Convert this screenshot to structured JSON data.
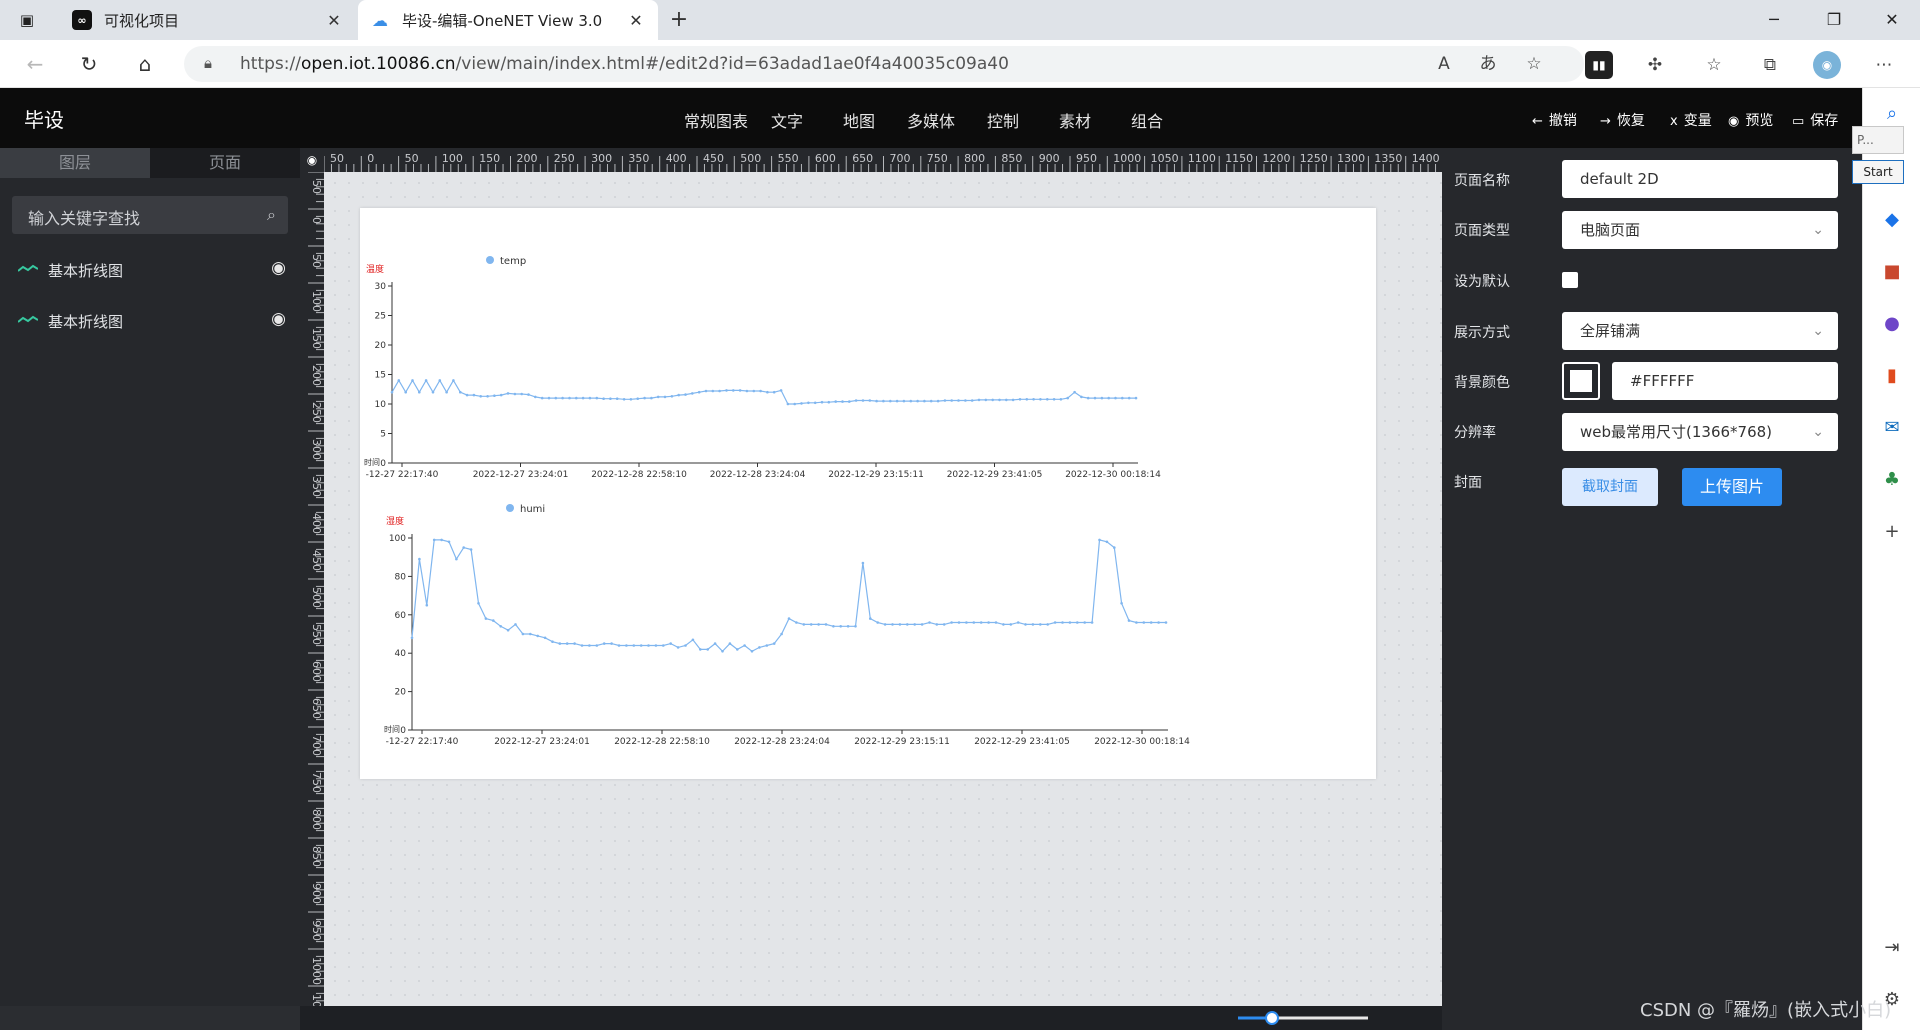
{
  "browser": {
    "tabs": [
      {
        "title": "可视化项目",
        "favicon": "onenet-logo"
      },
      {
        "title": "毕设-编辑-OneNET View 3.0",
        "favicon": "cloud-icon"
      }
    ],
    "url_prefix": "https://",
    "url_host": "open.iot.10086.cn",
    "url_path": "/view/main/index.html#/edit2d?id=63adad1ae0f4a40035c09a40"
  },
  "app": {
    "title": "毕设",
    "menu": [
      "常规图表",
      "文字",
      "地图",
      "多媒体",
      "控制",
      "素材",
      "组合"
    ],
    "tools": {
      "undo": "撤销",
      "redo": "恢复",
      "variable": "变量",
      "preview": "预览",
      "save": "保存"
    }
  },
  "left_panel": {
    "tabs": [
      "图层",
      "页面"
    ],
    "search_placeholder": "输入关键字查找",
    "layers": [
      "基本折线图",
      "基本折线图"
    ]
  },
  "ruler": {
    "h_labels": [
      "50",
      "0",
      "50",
      "100",
      "150",
      "200",
      "250",
      "300",
      "350",
      "400",
      "450",
      "500",
      "550",
      "600",
      "650",
      "700",
      "750",
      "800",
      "850",
      "900",
      "950",
      "1000",
      "1050",
      "1100",
      "1150",
      "1200",
      "1250",
      "1300",
      "1350",
      "1400"
    ],
    "v_labels": [
      "50",
      "0",
      "50",
      "100",
      "150",
      "200",
      "250",
      "300",
      "350",
      "400",
      "450",
      "500",
      "550",
      "600",
      "650",
      "700",
      "750",
      "800",
      "850",
      "900",
      "950",
      "1000",
      "10"
    ]
  },
  "right_panel": {
    "page_name_label": "页面名称",
    "page_name_value": "default 2D",
    "page_type_label": "页面类型",
    "page_type_value": "电脑页面",
    "default_label": "设为默认",
    "display_label": "展示方式",
    "display_value": "全屏铺满",
    "bg_label": "背景颜色",
    "bg_value": "#FFFFFF",
    "resolution_label": "分辨率",
    "resolution_value": "web最常用尺寸(1366*768)",
    "cover_label": "封面",
    "capture_btn": "截取封面",
    "upload_btn": "上传图片"
  },
  "edge_popups": {
    "p_label": "P...",
    "start_label": "Start"
  },
  "watermark": "CSDN @『羅炀』(嵌入式小白)",
  "chart_data": [
    {
      "type": "line",
      "series_name": "temp",
      "ylabel": "温度",
      "xlabel_short": "时间",
      "ylim": [
        0,
        30
      ],
      "yticks": [
        0,
        5,
        10,
        15,
        20,
        25,
        30
      ],
      "xtick_labels": [
        "-12-27 22:17:40",
        "2022-12-27 23:24:01",
        "2022-12-28 22:58:10",
        "2022-12-28 23:24:04",
        "2022-12-29 23:15:11",
        "2022-12-29 23:41:05",
        "2022-12-30 00:18:14"
      ],
      "series": [
        {
          "name": "temp",
          "color": "#80b6ef",
          "values": [
            12,
            14,
            12,
            14,
            12,
            14,
            12,
            14,
            12,
            14,
            12,
            11.5,
            11.5,
            11.3,
            11.3,
            11.4,
            11.5,
            11.8,
            11.7,
            11.7,
            11.6,
            11.2,
            11,
            11,
            11,
            11,
            11,
            11,
            11,
            11,
            11,
            10.9,
            10.9,
            10.9,
            10.8,
            10.8,
            10.9,
            11,
            11,
            11.2,
            11.2,
            11.3,
            11.5,
            11.6,
            11.8,
            12,
            12.2,
            12.2,
            12.2,
            12.3,
            12.3,
            12.3,
            12.2,
            12.2,
            12.2,
            12,
            12,
            12.3,
            10,
            10,
            10.1,
            10.2,
            10.2,
            10.3,
            10.3,
            10.4,
            10.4,
            10.4,
            10.6,
            10.6,
            10.6,
            10.5,
            10.5,
            10.5,
            10.5,
            10.5,
            10.5,
            10.5,
            10.5,
            10.5,
            10.5,
            10.6,
            10.6,
            10.6,
            10.6,
            10.6,
            10.7,
            10.7,
            10.7,
            10.7,
            10.7,
            10.7,
            10.8,
            10.8,
            10.8,
            10.8,
            10.8,
            10.8,
            10.8,
            11,
            12,
            11.2,
            11,
            11,
            11,
            11,
            11,
            11,
            11,
            11
          ]
        }
      ]
    },
    {
      "type": "line",
      "series_name": "humi",
      "ylabel": "湿度",
      "xlabel_short": "时间",
      "ylim": [
        0,
        100
      ],
      "yticks": [
        0,
        20,
        40,
        60,
        80,
        100
      ],
      "xtick_labels": [
        "-12-27 22:17:40",
        "2022-12-27 23:24:01",
        "2022-12-28 22:58:10",
        "2022-12-28 23:24:04",
        "2022-12-29 23:15:11",
        "2022-12-29 23:41:05",
        "2022-12-30 00:18:14"
      ],
      "series": [
        {
          "name": "humi",
          "color": "#80b6ef",
          "values": [
            48,
            89,
            65,
            99,
            99,
            98,
            89,
            95,
            94,
            66,
            58,
            57,
            54,
            52,
            55,
            50,
            50,
            49,
            48,
            46,
            45,
            45,
            45,
            44,
            44,
            44,
            45,
            45,
            44,
            44,
            44,
            44,
            44,
            44,
            44,
            45,
            43,
            44,
            47,
            42,
            42,
            45,
            41,
            45,
            42,
            44,
            41,
            43,
            44,
            45,
            50,
            58,
            56,
            55,
            55,
            55,
            55,
            54,
            54,
            54,
            54,
            87,
            58,
            56,
            55,
            55,
            55,
            55,
            55,
            55,
            56,
            55,
            55,
            56,
            56,
            56,
            56,
            56,
            56,
            56,
            55,
            55,
            56,
            55,
            55,
            55,
            55,
            56,
            56,
            56,
            56,
            56,
            56,
            99,
            98,
            95,
            66,
            57,
            56,
            56,
            56,
            56,
            56
          ]
        }
      ]
    }
  ]
}
